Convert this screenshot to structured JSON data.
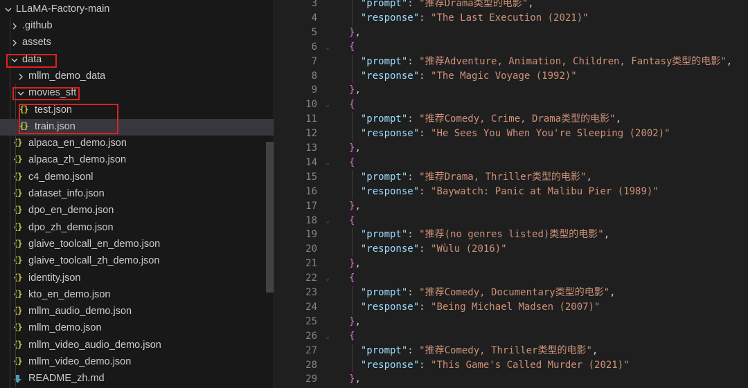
{
  "explorer": {
    "root": "LLaMA-Factory-main",
    "items": [
      {
        "label": ".github",
        "kind": "folder",
        "state": "collapsed",
        "depth": 1
      },
      {
        "label": "assets",
        "kind": "folder",
        "state": "collapsed",
        "depth": 1
      },
      {
        "label": "data",
        "kind": "folder",
        "state": "expanded",
        "depth": 1
      },
      {
        "label": "mllm_demo_data",
        "kind": "folder",
        "state": "collapsed",
        "depth": 2
      },
      {
        "label": "movies_sft",
        "kind": "folder",
        "state": "expanded",
        "depth": 2
      },
      {
        "label": "test.json",
        "kind": "json",
        "depth": 3
      },
      {
        "label": "train.json",
        "kind": "json",
        "depth": 3,
        "selected": true
      },
      {
        "label": "alpaca_en_demo.json",
        "kind": "json",
        "depth": 2
      },
      {
        "label": "alpaca_zh_demo.json",
        "kind": "json",
        "depth": 2
      },
      {
        "label": "c4_demo.jsonl",
        "kind": "json",
        "depth": 2
      },
      {
        "label": "dataset_info.json",
        "kind": "json",
        "depth": 2
      },
      {
        "label": "dpo_en_demo.json",
        "kind": "json",
        "depth": 2
      },
      {
        "label": "dpo_zh_demo.json",
        "kind": "json",
        "depth": 2
      },
      {
        "label": "glaive_toolcall_en_demo.json",
        "kind": "json",
        "depth": 2
      },
      {
        "label": "glaive_toolcall_zh_demo.json",
        "kind": "json",
        "depth": 2
      },
      {
        "label": "identity.json",
        "kind": "json",
        "depth": 2
      },
      {
        "label": "kto_en_demo.json",
        "kind": "json",
        "depth": 2
      },
      {
        "label": "mllm_audio_demo.json",
        "kind": "json",
        "depth": 2
      },
      {
        "label": "mllm_demo.json",
        "kind": "json",
        "depth": 2
      },
      {
        "label": "mllm_video_audio_demo.json",
        "kind": "json",
        "depth": 2
      },
      {
        "label": "mllm_video_demo.json",
        "kind": "json",
        "depth": 2
      },
      {
        "label": "README_zh.md",
        "kind": "md",
        "depth": 2
      }
    ]
  },
  "icons": {
    "json": "json-file-icon",
    "md": "markdown-file-icon",
    "chevron_right": "chevron-right-icon",
    "chevron_down": "chevron-down-icon"
  },
  "colors": {
    "highlight_box": "#e02020",
    "json_icon": "#cbcb41",
    "key": "#9cdcfe",
    "string": "#ce9178",
    "brace": "#da70d6"
  },
  "editor": {
    "lines": [
      {
        "n": "3",
        "t": "kv",
        "key": "\"prompt\"",
        "val": "\"推荐Drama类型的电影\"",
        "comma": true
      },
      {
        "n": "4",
        "t": "kv",
        "key": "\"response\"",
        "val": "\"The Last Execution (2021)\"",
        "comma": false
      },
      {
        "n": "5",
        "t": "close",
        "text": "},"
      },
      {
        "n": "6",
        "t": "open",
        "text": "{"
      },
      {
        "n": "7",
        "t": "kv",
        "key": "\"prompt\"",
        "val": "\"推荐Adventure, Animation, Children, Fantasy类型的电影\"",
        "comma": true
      },
      {
        "n": "8",
        "t": "kv",
        "key": "\"response\"",
        "val": "\"The Magic Voyage (1992)\"",
        "comma": false
      },
      {
        "n": "9",
        "t": "close",
        "text": "},"
      },
      {
        "n": "10",
        "t": "open",
        "text": "{"
      },
      {
        "n": "11",
        "t": "kv",
        "key": "\"prompt\"",
        "val": "\"推荐Comedy, Crime, Drama类型的电影\"",
        "comma": true
      },
      {
        "n": "12",
        "t": "kv",
        "key": "\"response\"",
        "val": "\"He Sees You When You're Sleeping (2002)\"",
        "comma": false
      },
      {
        "n": "13",
        "t": "close",
        "text": "},"
      },
      {
        "n": "14",
        "t": "open",
        "text": "{"
      },
      {
        "n": "15",
        "t": "kv",
        "key": "\"prompt\"",
        "val": "\"推荐Drama, Thriller类型的电影\"",
        "comma": true
      },
      {
        "n": "16",
        "t": "kv",
        "key": "\"response\"",
        "val": "\"Baywatch: Panic at Malibu Pier (1989)\"",
        "comma": false
      },
      {
        "n": "17",
        "t": "close",
        "text": "},"
      },
      {
        "n": "18",
        "t": "open",
        "text": "{"
      },
      {
        "n": "19",
        "t": "kv",
        "key": "\"prompt\"",
        "val": "\"推荐(no genres listed)类型的电影\"",
        "comma": true
      },
      {
        "n": "20",
        "t": "kv",
        "key": "\"response\"",
        "val": "\"Wùlu (2016)\"",
        "comma": false
      },
      {
        "n": "21",
        "t": "close",
        "text": "},"
      },
      {
        "n": "22",
        "t": "open",
        "text": "{"
      },
      {
        "n": "23",
        "t": "kv",
        "key": "\"prompt\"",
        "val": "\"推荐Comedy, Documentary类型的电影\"",
        "comma": true
      },
      {
        "n": "24",
        "t": "kv",
        "key": "\"response\"",
        "val": "\"Being Michael Madsen (2007)\"",
        "comma": false
      },
      {
        "n": "25",
        "t": "close",
        "text": "},"
      },
      {
        "n": "26",
        "t": "open",
        "text": "{"
      },
      {
        "n": "27",
        "t": "kv",
        "key": "\"prompt\"",
        "val": "\"推荐Comedy, Thriller类型的电影\"",
        "comma": true
      },
      {
        "n": "28",
        "t": "kv",
        "key": "\"response\"",
        "val": "\"This Game's Called Murder (2021)\"",
        "comma": false
      },
      {
        "n": "29",
        "t": "close",
        "text": "},"
      }
    ]
  }
}
